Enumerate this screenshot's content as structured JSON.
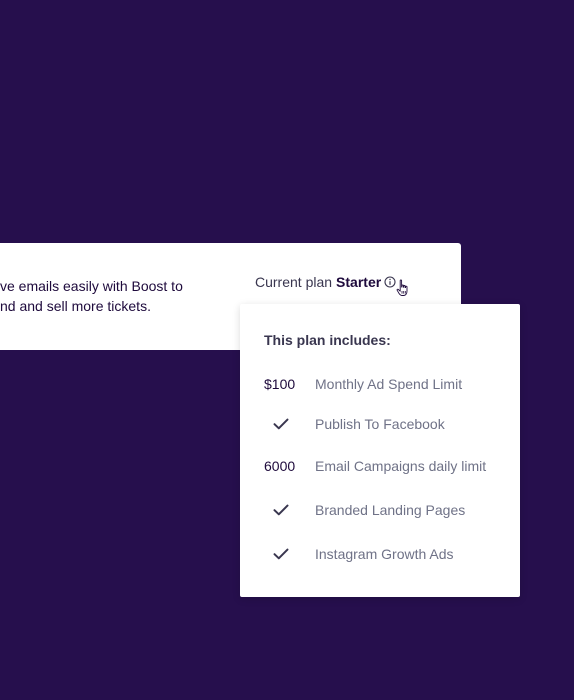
{
  "banner": {
    "text_line_1": "ve emails easily with Boost to",
    "text_line_2": "nd and sell more tickets."
  },
  "current_plan": {
    "label": "Current plan",
    "plan_name": "Starter",
    "info_icon": "info-circle-icon",
    "cursor_icon": "hand-pointer-icon"
  },
  "popover": {
    "title": "This plan includes:",
    "features": [
      {
        "value": "$100",
        "icon": null,
        "label": "Monthly Ad Spend Limit"
      },
      {
        "value": null,
        "icon": "check-icon",
        "label": "Publish To Facebook"
      },
      {
        "value": "6000",
        "icon": null,
        "label": "Email Campaigns daily limit"
      },
      {
        "value": null,
        "icon": "check-icon",
        "label": "Branded Landing Pages"
      },
      {
        "value": null,
        "icon": "check-icon",
        "label": "Instagram Growth Ads"
      }
    ]
  },
  "colors": {
    "background": "#260f4d",
    "text_dark": "#1e0a3c",
    "text_muted": "#6f7287"
  }
}
